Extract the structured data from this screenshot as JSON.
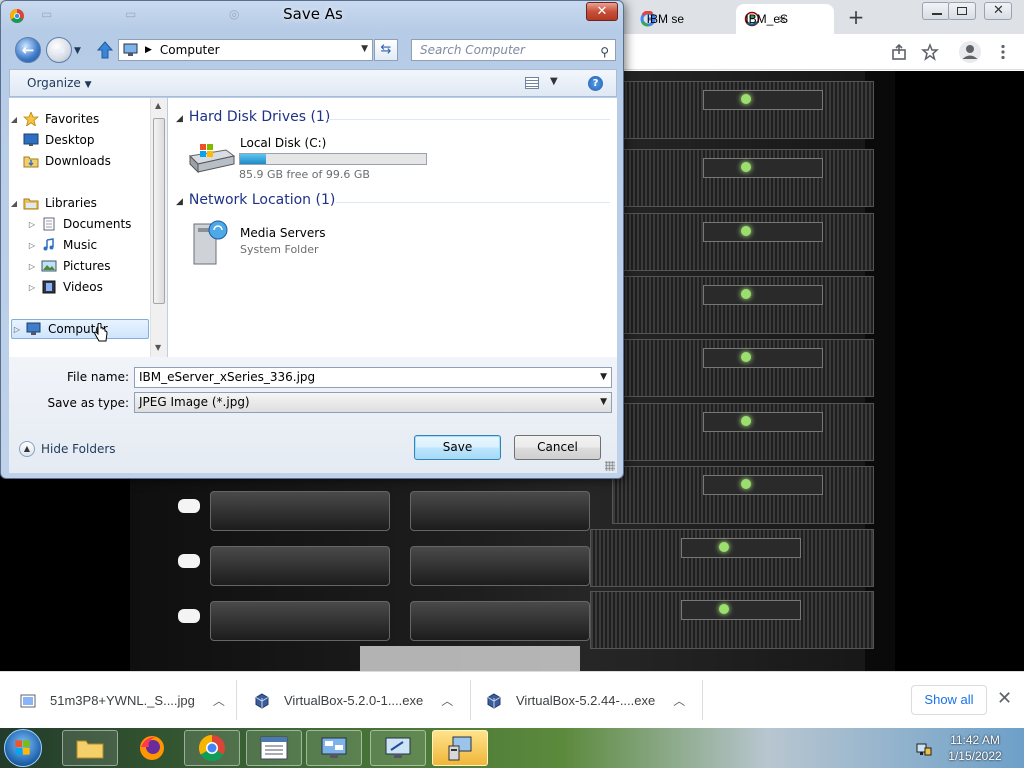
{
  "browser": {
    "tabs": [
      {
        "label": "IBM se",
        "active": false
      },
      {
        "label": "IBM_eS",
        "active": true
      }
    ],
    "new_tab": "+",
    "tab_close": "×",
    "window_controls": [
      "minimize",
      "maximize",
      "close"
    ]
  },
  "dialog": {
    "title": "Save As",
    "address_path": "Computer",
    "search_placeholder": "Search Computer",
    "organize_label": "Organize",
    "nav": {
      "favorites": "Favorites",
      "desktop": "Desktop",
      "downloads": "Downloads",
      "libraries": "Libraries",
      "documents": "Documents",
      "music": "Music",
      "pictures": "Pictures",
      "videos": "Videos",
      "computer": "Computer"
    },
    "groups": {
      "hard_disks": {
        "header": "Hard Disk Drives (1)",
        "item_name": "Local Disk (C:)",
        "item_detail": "85.9 GB free of 99.6 GB",
        "used_fraction": 0.14
      },
      "network": {
        "header": "Network Location (1)",
        "item_name": "Media Servers",
        "item_detail": "System Folder"
      }
    },
    "file_name_label": "File name:",
    "file_name_value": "IBM_eServer_xSeries_336.jpg",
    "save_type_label": "Save as type:",
    "save_type_value": "JPEG Image (*.jpg)",
    "hide_folders": "Hide Folders",
    "save_button": "Save",
    "cancel_button": "Cancel"
  },
  "downloads": {
    "items": [
      {
        "name": "51m3P8+YWNL._S....jpg"
      },
      {
        "name": "VirtualBox-5.2.0-1....exe"
      },
      {
        "name": "VirtualBox-5.2.44-....exe"
      }
    ],
    "show_all": "Show all"
  },
  "taskbar": {
    "clock_time": "11:42 AM",
    "clock_date": "1/15/2022"
  },
  "colors": {
    "accent_blue": "#1a73e8",
    "dialog_frame": "#bfd2ea",
    "group_header": "#1e3287"
  }
}
